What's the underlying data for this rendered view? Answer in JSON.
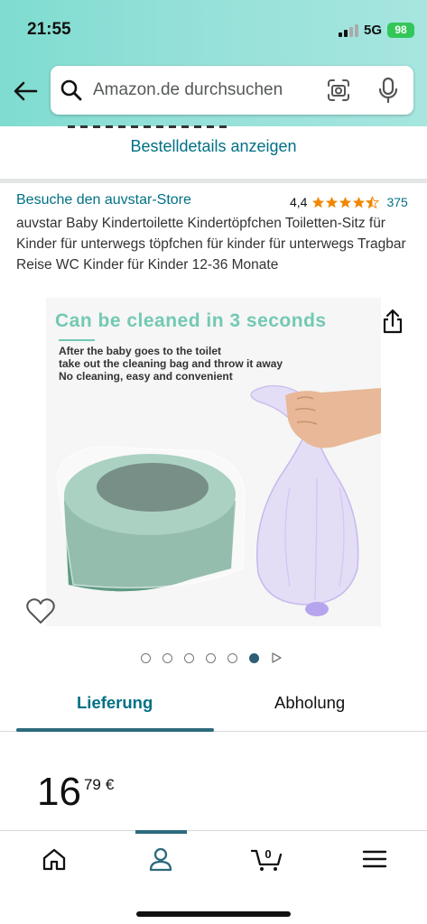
{
  "status_bar": {
    "time": "21:55",
    "network": "5G",
    "battery": "98"
  },
  "search": {
    "placeholder": "Amazon.de durchsuchen",
    "back_icon": "back-arrow-icon",
    "search_icon": "search-icon",
    "camera_icon": "camera-icon",
    "mic_icon": "mic-icon"
  },
  "order": {
    "link_label": "Bestelldetails anzeigen"
  },
  "product": {
    "store_link": "Besuche den auvstar-Store",
    "rating_value": "4,4",
    "rating": 4.4,
    "rating_count": "375",
    "title": "auvstar Baby Kindertoilette Kindertöpfchen Toiletten-Sitz für Kinder für unterwegs töpfchen für kinder für unterwegs Tragbar Reise WC Kinder für Kinder 12-36 Monate",
    "image": {
      "headline": "Can be cleaned in 3 seconds",
      "line1": "After the baby goes to the toilet",
      "line2": "take out the cleaning bag and throw it away",
      "line3": "No cleaning, easy and convenient"
    },
    "image_count": 6,
    "active_image": 6
  },
  "tabs": {
    "delivery": "Lieferung",
    "pickup": "Abholung"
  },
  "price": {
    "whole": "16",
    "fraction": "79",
    "currency": "€"
  },
  "nav": {
    "items": [
      "home-icon",
      "account-icon",
      "cart-icon",
      "menu-icon"
    ],
    "cart_count": "0",
    "active": "account-icon"
  },
  "colors": {
    "header_gradient": "#93e0d8",
    "link": "#007185",
    "accent": "#2d6a7c",
    "star": "#f08804",
    "image_headline": "#73c9b4"
  }
}
